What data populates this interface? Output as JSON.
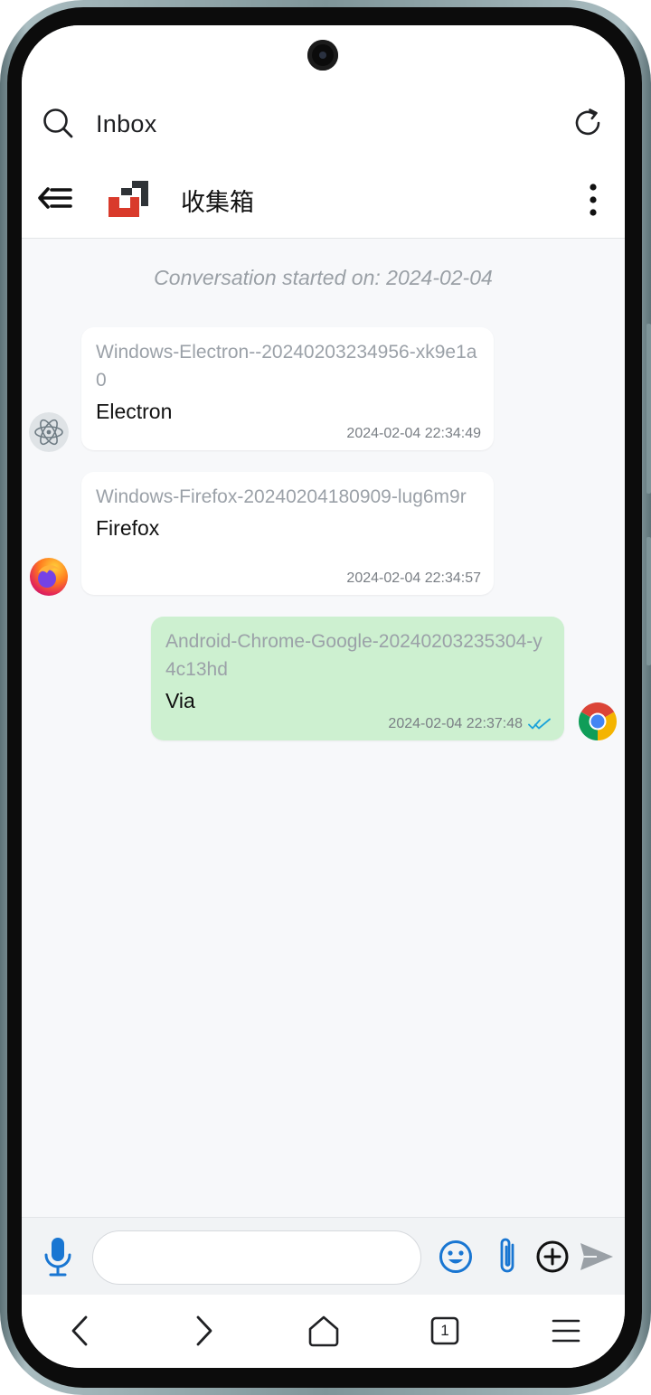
{
  "browser": {
    "url_text": "Inbox",
    "tab_count": "1"
  },
  "header": {
    "title": "收集箱"
  },
  "conversation": {
    "started_text": "Conversation started on: 2024-02-04",
    "messages": [
      {
        "device": "Windows-Electron--20240203234956-xk9e1a0",
        "text": "Electron",
        "time": "2024-02-04 22:34:49",
        "direction": "in",
        "avatar": "electron-icon"
      },
      {
        "device": "Windows-Firefox-20240204180909-lug6m9r",
        "text": "Firefox",
        "time": "2024-02-04 22:34:57",
        "direction": "in",
        "avatar": "firefox-icon"
      },
      {
        "device": "Android-Chrome-Google-20240203235304-y4c13hd",
        "text": "Via",
        "time": "2024-02-04 22:37:48",
        "direction": "out",
        "avatar": "chrome-icon",
        "status": "read"
      }
    ]
  },
  "composer": {
    "value": "",
    "placeholder": ""
  },
  "colors": {
    "accent_blue": "#1976d2",
    "outgoing_bubble": "#cdf0d0",
    "logo_red": "#d93a2b",
    "logo_dark": "#2f3337",
    "read_check": "#1ca3d9"
  }
}
